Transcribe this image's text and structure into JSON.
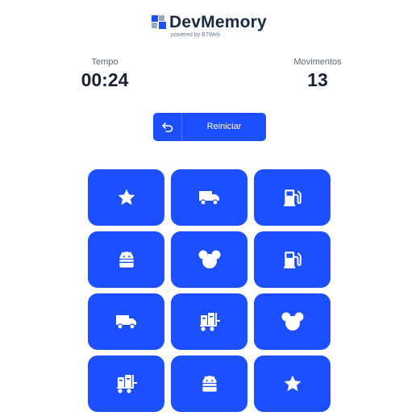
{
  "brand": {
    "title": "DevMemory",
    "subtitle": "powered by B7Web",
    "accent": "#1b4fff"
  },
  "stats": {
    "time_label": "Tempo",
    "time_value": "00:24",
    "moves_label": "Movimentos",
    "moves_value": "13"
  },
  "restart": {
    "label": "Reiniciar",
    "icon": "undo-icon"
  },
  "cards": [
    {
      "icon": "star-icon"
    },
    {
      "icon": "truck-icon"
    },
    {
      "icon": "gas-pump-icon"
    },
    {
      "icon": "android-icon"
    },
    {
      "icon": "mouse-head-icon"
    },
    {
      "icon": "gas-pump-icon"
    },
    {
      "icon": "truck-icon"
    },
    {
      "icon": "luggage-cart-icon"
    },
    {
      "icon": "mouse-head-icon"
    },
    {
      "icon": "luggage-cart-icon"
    },
    {
      "icon": "android-icon"
    },
    {
      "icon": "star-icon"
    }
  ]
}
